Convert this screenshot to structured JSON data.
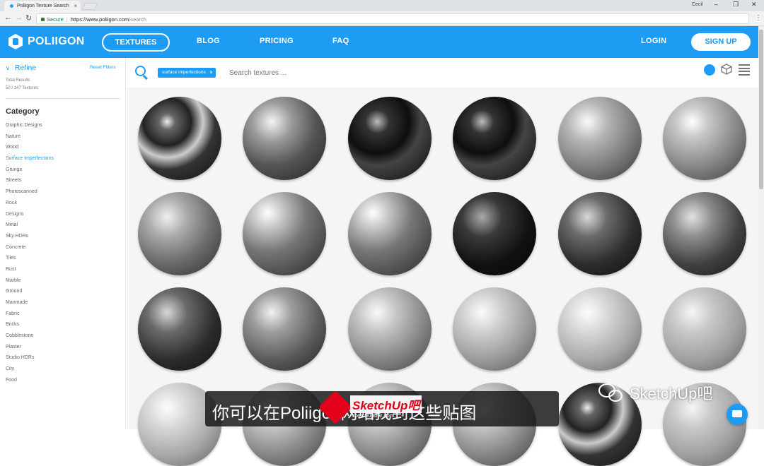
{
  "browser": {
    "tab_title": "Poliigon Texture Search",
    "tab_close": "×",
    "user_label": "Cecil",
    "url_secure": "Secure",
    "url_host": "https://www.poliigon.com",
    "url_path": "/search",
    "window_controls": {
      "minimize": "–",
      "maximize": "❐",
      "close": "✕"
    }
  },
  "site": {
    "logo": "POLIIGON",
    "nav": {
      "textures": "TEXTURES",
      "blog": "BLOG",
      "pricing": "PRICING",
      "faq": "FAQ"
    },
    "login": "LOGIN",
    "signup": "SIGN UP"
  },
  "sidebar": {
    "refine": "Refine",
    "reset_filters": "Reset Filters",
    "total_results_label": "Total Results",
    "total_results_value": "50 / 147 Textures",
    "category_heading": "Category",
    "categories": [
      "Graphic Designs",
      "Nature",
      "Wood",
      "Surface Imperfections",
      "Grunge",
      "Streets",
      "Photoscanned",
      "Rock",
      "Designs",
      "Metal",
      "Sky HDRs",
      "Concrete",
      "Tiles",
      "Rust",
      "Marble",
      "Ground",
      "Manmade",
      "Fabric",
      "Bricks",
      "Cobblestone",
      "Plaster",
      "Studio HDRs",
      "City",
      "Food"
    ],
    "active_category": "Surface Imperfections"
  },
  "search": {
    "chip_label": "surface imperfections",
    "chip_remove": "x",
    "placeholder": "Search textures ..."
  },
  "view_icons": [
    "sphere-view-icon",
    "cube-view-icon",
    "list-view-icon"
  ],
  "colors": {
    "accent": "#1e9cf4"
  },
  "textures": [
    {
      "style": "smudge"
    },
    {
      "style": "scratch"
    },
    {
      "style": "swirl-dark"
    },
    {
      "style": "swirl-dark"
    },
    {
      "style": "stain"
    },
    {
      "style": "droplets"
    },
    {
      "style": "water-drops"
    },
    {
      "style": "glass-drops"
    },
    {
      "style": "glass-drops"
    },
    {
      "style": "bubbles"
    },
    {
      "style": "patchy-dark"
    },
    {
      "style": "patchy"
    },
    {
      "style": "patchy-dark"
    },
    {
      "style": "scratched"
    },
    {
      "style": "worn"
    },
    {
      "style": "wood-light"
    },
    {
      "style": "worn-light"
    },
    {
      "style": "smooth-grey"
    },
    {
      "style": "worn-light"
    },
    {
      "style": "worn"
    },
    {
      "style": "worn"
    },
    {
      "style": "worn"
    },
    {
      "style": "smudge"
    },
    {
      "style": "smooth-grey"
    }
  ],
  "overlay": {
    "caption": "你可以在Poliigon网站找到这些贴图",
    "watermark": "SketchUp吧",
    "watermark_url": "sketchupbar.com",
    "brand": "SketchUp吧"
  }
}
